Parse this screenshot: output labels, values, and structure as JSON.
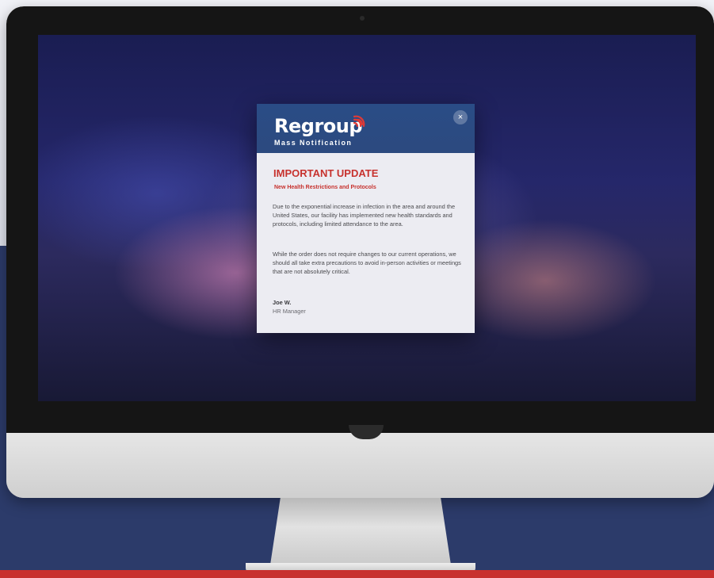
{
  "modal": {
    "brand": "Regroup",
    "brand_sub": "Mass Notification",
    "close_label": "×",
    "title": "IMPORTANT UPDATE",
    "subtitle": "New Health Restrictions and Protocols",
    "paragraph_1": "Due to the exponential increase in infection in the area and around the United States, our facility has implemented new health standards and protocols, including limited attendance to the area.",
    "paragraph_2": "While the order does not require changes to our current operations, we should all take extra precautions to avoid in-person activities or meetings that are not absolutely critical.",
    "signer_name": "Joe W.",
    "signer_role": "HR Manager"
  },
  "colors": {
    "header": "#2a4c86",
    "accent_red": "#c7322e",
    "page_navy": "#2c3b6a",
    "bottom_red": "#c8312f"
  },
  "icons": {
    "logo": "signal-waves-icon",
    "close": "close-icon"
  }
}
